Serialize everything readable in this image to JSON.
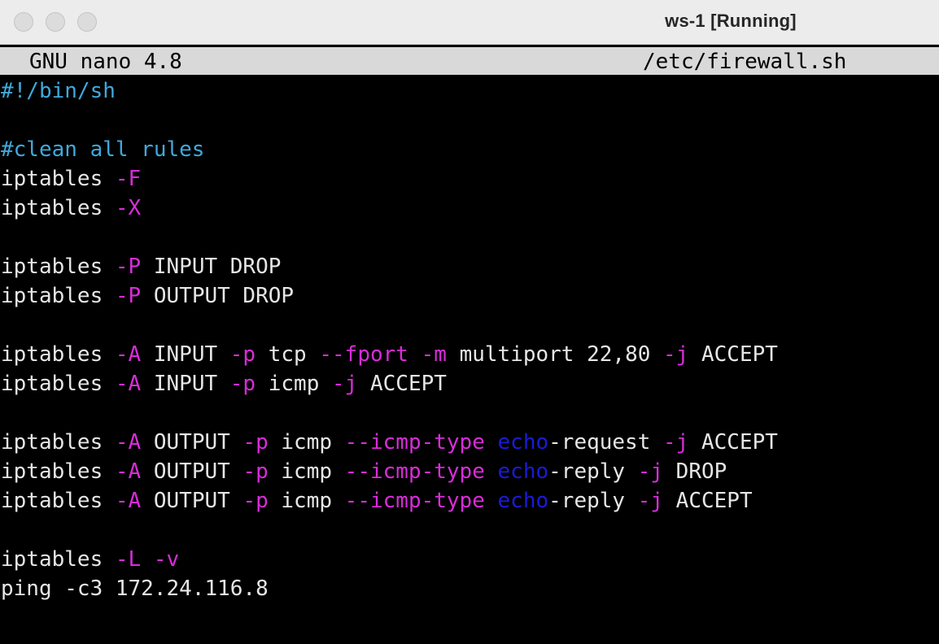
{
  "window": {
    "title": "ws-1 [Running]"
  },
  "nano": {
    "version": "GNU nano 4.8",
    "filename": "/etc/firewall.sh"
  },
  "colors": {
    "comment": "#3fa9dc",
    "flag": "#d92cd9",
    "echo": "#1b1bd6",
    "text": "#e6e6e6",
    "header_bg": "#d9d9d9",
    "background": "#000000"
  },
  "lines": [
    [
      {
        "t": "#!/bin/sh",
        "c": "comment"
      }
    ],
    [],
    [
      {
        "t": "#clean all rules",
        "c": "comment"
      }
    ],
    [
      {
        "t": "iptables ",
        "c": "plain"
      },
      {
        "t": "-F",
        "c": "flag"
      }
    ],
    [
      {
        "t": "iptables ",
        "c": "plain"
      },
      {
        "t": "-X",
        "c": "flag"
      }
    ],
    [],
    [
      {
        "t": "iptables ",
        "c": "plain"
      },
      {
        "t": "-P",
        "c": "flag"
      },
      {
        "t": " INPUT DROP",
        "c": "plain"
      }
    ],
    [
      {
        "t": "iptables ",
        "c": "plain"
      },
      {
        "t": "-P",
        "c": "flag"
      },
      {
        "t": " OUTPUT DROP",
        "c": "plain"
      }
    ],
    [],
    [
      {
        "t": "iptables ",
        "c": "plain"
      },
      {
        "t": "-A",
        "c": "flag"
      },
      {
        "t": " INPUT ",
        "c": "plain"
      },
      {
        "t": "-p",
        "c": "flag"
      },
      {
        "t": " tcp ",
        "c": "plain"
      },
      {
        "t": "--fport",
        "c": "flag"
      },
      {
        "t": " ",
        "c": "plain"
      },
      {
        "t": "-m",
        "c": "flag"
      },
      {
        "t": " multiport 22,80 ",
        "c": "plain"
      },
      {
        "t": "-j",
        "c": "flag"
      },
      {
        "t": " ACCEPT",
        "c": "plain"
      }
    ],
    [
      {
        "t": "iptables ",
        "c": "plain"
      },
      {
        "t": "-A",
        "c": "flag"
      },
      {
        "t": " INPUT ",
        "c": "plain"
      },
      {
        "t": "-p",
        "c": "flag"
      },
      {
        "t": " icmp ",
        "c": "plain"
      },
      {
        "t": "-j",
        "c": "flag"
      },
      {
        "t": " ACCEPT",
        "c": "plain"
      }
    ],
    [],
    [
      {
        "t": "iptables ",
        "c": "plain"
      },
      {
        "t": "-A",
        "c": "flag"
      },
      {
        "t": " OUTPUT ",
        "c": "plain"
      },
      {
        "t": "-p",
        "c": "flag"
      },
      {
        "t": " icmp ",
        "c": "plain"
      },
      {
        "t": "--icmp-type",
        "c": "flag"
      },
      {
        "t": " ",
        "c": "plain"
      },
      {
        "t": "echo",
        "c": "echo"
      },
      {
        "t": "-request ",
        "c": "plain"
      },
      {
        "t": "-j",
        "c": "flag"
      },
      {
        "t": " ACCEPT",
        "c": "plain"
      }
    ],
    [
      {
        "t": "iptables ",
        "c": "plain"
      },
      {
        "t": "-A",
        "c": "flag"
      },
      {
        "t": " OUTPUT ",
        "c": "plain"
      },
      {
        "t": "-p",
        "c": "flag"
      },
      {
        "t": " icmp ",
        "c": "plain"
      },
      {
        "t": "--icmp-type",
        "c": "flag"
      },
      {
        "t": " ",
        "c": "plain"
      },
      {
        "t": "echo",
        "c": "echo"
      },
      {
        "t": "-reply ",
        "c": "plain"
      },
      {
        "t": "-j",
        "c": "flag"
      },
      {
        "t": " DROP",
        "c": "plain"
      }
    ],
    [
      {
        "t": "iptables ",
        "c": "plain"
      },
      {
        "t": "-A",
        "c": "flag"
      },
      {
        "t": " OUTPUT ",
        "c": "plain"
      },
      {
        "t": "-p",
        "c": "flag"
      },
      {
        "t": " icmp ",
        "c": "plain"
      },
      {
        "t": "--icmp-type",
        "c": "flag"
      },
      {
        "t": " ",
        "c": "plain"
      },
      {
        "t": "echo",
        "c": "echo"
      },
      {
        "t": "-reply ",
        "c": "plain"
      },
      {
        "t": "-j",
        "c": "flag"
      },
      {
        "t": " ACCEPT",
        "c": "plain"
      }
    ],
    [],
    [
      {
        "t": "iptables ",
        "c": "plain"
      },
      {
        "t": "-L",
        "c": "flag"
      },
      {
        "t": " ",
        "c": "plain"
      },
      {
        "t": "-v",
        "c": "flag"
      }
    ],
    [
      {
        "t": "ping -c3 172.24.116.8",
        "c": "plain"
      }
    ]
  ]
}
